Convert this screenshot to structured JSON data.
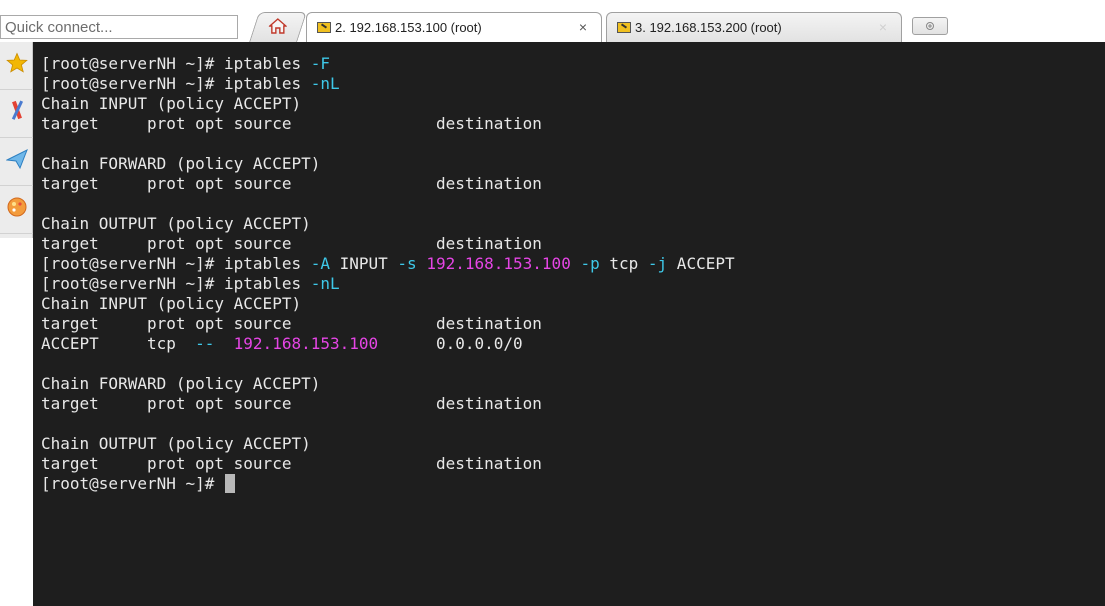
{
  "quick_connect": {
    "placeholder": "Quick connect..."
  },
  "tabs": [
    {
      "icon": "home-icon"
    },
    {
      "label": "2. 192.168.153.100 (root)",
      "active": true,
      "close": "×"
    },
    {
      "label": "3. 192.168.153.200 (root)",
      "active": false,
      "close": "×"
    }
  ],
  "new_tab": {
    "icon": "new-tab-icon"
  },
  "sidebar": {
    "items": [
      {
        "icon": "star-icon"
      },
      {
        "icon": "tools-icon"
      },
      {
        "icon": "send-icon"
      },
      {
        "icon": "palette-icon"
      }
    ]
  },
  "terminal": {
    "colors": {
      "background": "#1e1e1e",
      "text": "#e8e8e8",
      "flag": "#3ec8e8",
      "ip": "#e545e5"
    },
    "lines": [
      [
        {
          "t": "[root@serverNH ~]# iptables "
        },
        {
          "t": "-F",
          "c": "flag"
        }
      ],
      [
        {
          "t": "[root@serverNH ~]# iptables "
        },
        {
          "t": "-nL",
          "c": "flag"
        }
      ],
      [
        {
          "t": "Chain INPUT (policy ACCEPT)"
        }
      ],
      [
        {
          "t": "target     prot opt source               destination"
        }
      ],
      [
        {
          "t": ""
        }
      ],
      [
        {
          "t": "Chain FORWARD (policy ACCEPT)"
        }
      ],
      [
        {
          "t": "target     prot opt source               destination"
        }
      ],
      [
        {
          "t": ""
        }
      ],
      [
        {
          "t": "Chain OUTPUT (policy ACCEPT)"
        }
      ],
      [
        {
          "t": "target     prot opt source               destination"
        }
      ],
      [
        {
          "t": "[root@serverNH ~]# iptables "
        },
        {
          "t": "-A",
          "c": "flag"
        },
        {
          "t": " INPUT "
        },
        {
          "t": "-s",
          "c": "flag"
        },
        {
          "t": " "
        },
        {
          "t": "192.168.153.100",
          "c": "ip"
        },
        {
          "t": " "
        },
        {
          "t": "-p",
          "c": "flag"
        },
        {
          "t": " tcp "
        },
        {
          "t": "-j",
          "c": "flag"
        },
        {
          "t": " ACCEPT"
        }
      ],
      [
        {
          "t": "[root@serverNH ~]# iptables "
        },
        {
          "t": "-nL",
          "c": "flag"
        }
      ],
      [
        {
          "t": "Chain INPUT (policy ACCEPT)"
        }
      ],
      [
        {
          "t": "target     prot opt source               destination"
        }
      ],
      [
        {
          "t": "ACCEPT     tcp  "
        },
        {
          "t": "--",
          "c": "flag"
        },
        {
          "t": "  "
        },
        {
          "t": "192.168.153.100",
          "c": "ip"
        },
        {
          "t": "      0.0.0.0/0"
        }
      ],
      [
        {
          "t": ""
        }
      ],
      [
        {
          "t": "Chain FORWARD (policy ACCEPT)"
        }
      ],
      [
        {
          "t": "target     prot opt source               destination"
        }
      ],
      [
        {
          "t": ""
        }
      ],
      [
        {
          "t": "Chain OUTPUT (policy ACCEPT)"
        }
      ],
      [
        {
          "t": "target     prot opt source               destination"
        }
      ],
      [
        {
          "t": "[root@serverNH ~]# "
        }
      ]
    ]
  }
}
